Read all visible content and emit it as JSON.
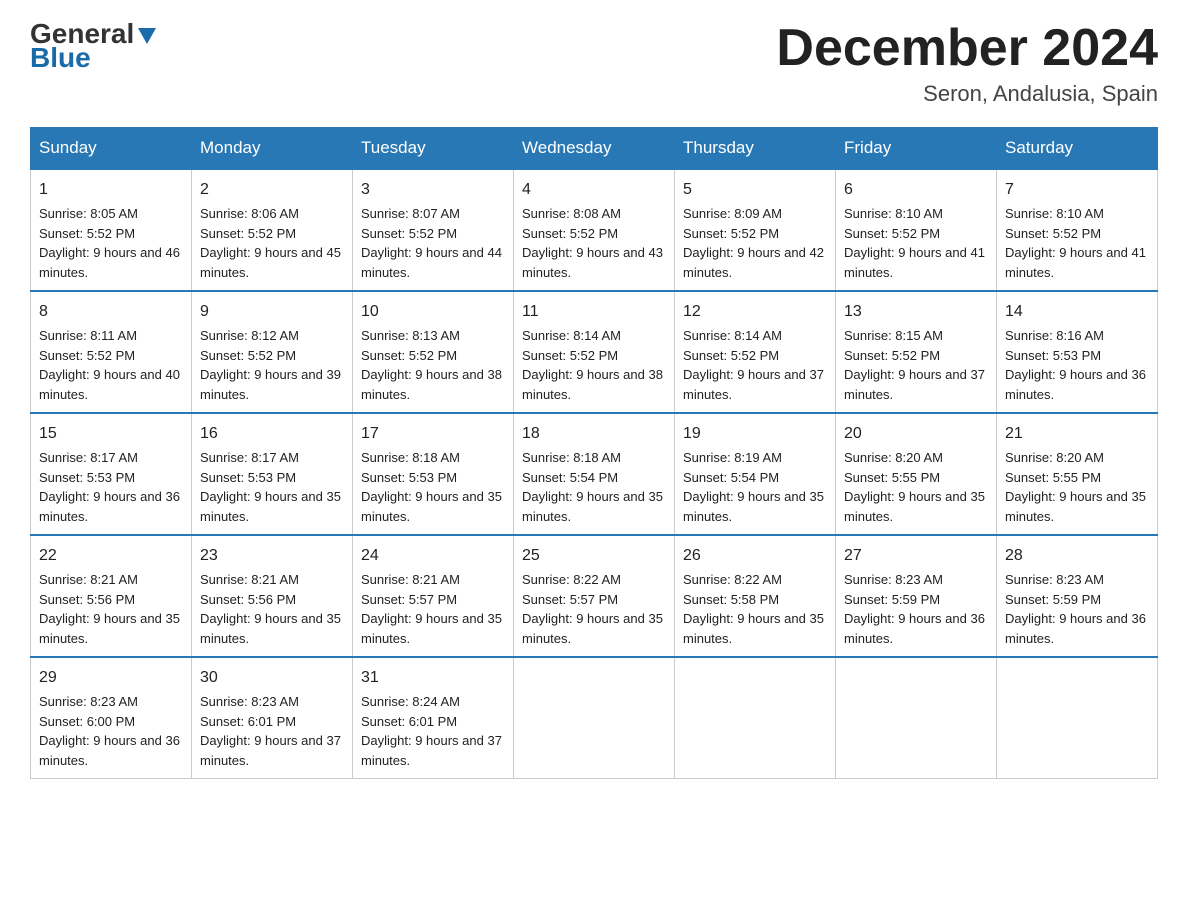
{
  "header": {
    "logo_general": "General",
    "logo_blue": "Blue",
    "month_title": "December 2024",
    "location": "Seron, Andalusia, Spain"
  },
  "days_of_week": [
    "Sunday",
    "Monday",
    "Tuesday",
    "Wednesday",
    "Thursday",
    "Friday",
    "Saturday"
  ],
  "weeks": [
    [
      {
        "day": "1",
        "sunrise": "8:05 AM",
        "sunset": "5:52 PM",
        "daylight": "9 hours and 46 minutes."
      },
      {
        "day": "2",
        "sunrise": "8:06 AM",
        "sunset": "5:52 PM",
        "daylight": "9 hours and 45 minutes."
      },
      {
        "day": "3",
        "sunrise": "8:07 AM",
        "sunset": "5:52 PM",
        "daylight": "9 hours and 44 minutes."
      },
      {
        "day": "4",
        "sunrise": "8:08 AM",
        "sunset": "5:52 PM",
        "daylight": "9 hours and 43 minutes."
      },
      {
        "day": "5",
        "sunrise": "8:09 AM",
        "sunset": "5:52 PM",
        "daylight": "9 hours and 42 minutes."
      },
      {
        "day": "6",
        "sunrise": "8:10 AM",
        "sunset": "5:52 PM",
        "daylight": "9 hours and 41 minutes."
      },
      {
        "day": "7",
        "sunrise": "8:10 AM",
        "sunset": "5:52 PM",
        "daylight": "9 hours and 41 minutes."
      }
    ],
    [
      {
        "day": "8",
        "sunrise": "8:11 AM",
        "sunset": "5:52 PM",
        "daylight": "9 hours and 40 minutes."
      },
      {
        "day": "9",
        "sunrise": "8:12 AM",
        "sunset": "5:52 PM",
        "daylight": "9 hours and 39 minutes."
      },
      {
        "day": "10",
        "sunrise": "8:13 AM",
        "sunset": "5:52 PM",
        "daylight": "9 hours and 38 minutes."
      },
      {
        "day": "11",
        "sunrise": "8:14 AM",
        "sunset": "5:52 PM",
        "daylight": "9 hours and 38 minutes."
      },
      {
        "day": "12",
        "sunrise": "8:14 AM",
        "sunset": "5:52 PM",
        "daylight": "9 hours and 37 minutes."
      },
      {
        "day": "13",
        "sunrise": "8:15 AM",
        "sunset": "5:52 PM",
        "daylight": "9 hours and 37 minutes."
      },
      {
        "day": "14",
        "sunrise": "8:16 AM",
        "sunset": "5:53 PM",
        "daylight": "9 hours and 36 minutes."
      }
    ],
    [
      {
        "day": "15",
        "sunrise": "8:17 AM",
        "sunset": "5:53 PM",
        "daylight": "9 hours and 36 minutes."
      },
      {
        "day": "16",
        "sunrise": "8:17 AM",
        "sunset": "5:53 PM",
        "daylight": "9 hours and 35 minutes."
      },
      {
        "day": "17",
        "sunrise": "8:18 AM",
        "sunset": "5:53 PM",
        "daylight": "9 hours and 35 minutes."
      },
      {
        "day": "18",
        "sunrise": "8:18 AM",
        "sunset": "5:54 PM",
        "daylight": "9 hours and 35 minutes."
      },
      {
        "day": "19",
        "sunrise": "8:19 AM",
        "sunset": "5:54 PM",
        "daylight": "9 hours and 35 minutes."
      },
      {
        "day": "20",
        "sunrise": "8:20 AM",
        "sunset": "5:55 PM",
        "daylight": "9 hours and 35 minutes."
      },
      {
        "day": "21",
        "sunrise": "8:20 AM",
        "sunset": "5:55 PM",
        "daylight": "9 hours and 35 minutes."
      }
    ],
    [
      {
        "day": "22",
        "sunrise": "8:21 AM",
        "sunset": "5:56 PM",
        "daylight": "9 hours and 35 minutes."
      },
      {
        "day": "23",
        "sunrise": "8:21 AM",
        "sunset": "5:56 PM",
        "daylight": "9 hours and 35 minutes."
      },
      {
        "day": "24",
        "sunrise": "8:21 AM",
        "sunset": "5:57 PM",
        "daylight": "9 hours and 35 minutes."
      },
      {
        "day": "25",
        "sunrise": "8:22 AM",
        "sunset": "5:57 PM",
        "daylight": "9 hours and 35 minutes."
      },
      {
        "day": "26",
        "sunrise": "8:22 AM",
        "sunset": "5:58 PM",
        "daylight": "9 hours and 35 minutes."
      },
      {
        "day": "27",
        "sunrise": "8:23 AM",
        "sunset": "5:59 PM",
        "daylight": "9 hours and 36 minutes."
      },
      {
        "day": "28",
        "sunrise": "8:23 AM",
        "sunset": "5:59 PM",
        "daylight": "9 hours and 36 minutes."
      }
    ],
    [
      {
        "day": "29",
        "sunrise": "8:23 AM",
        "sunset": "6:00 PM",
        "daylight": "9 hours and 36 minutes."
      },
      {
        "day": "30",
        "sunrise": "8:23 AM",
        "sunset": "6:01 PM",
        "daylight": "9 hours and 37 minutes."
      },
      {
        "day": "31",
        "sunrise": "8:24 AM",
        "sunset": "6:01 PM",
        "daylight": "9 hours and 37 minutes."
      },
      null,
      null,
      null,
      null
    ]
  ],
  "labels": {
    "sunrise_prefix": "Sunrise: ",
    "sunset_prefix": "Sunset: ",
    "daylight_prefix": "Daylight: "
  }
}
